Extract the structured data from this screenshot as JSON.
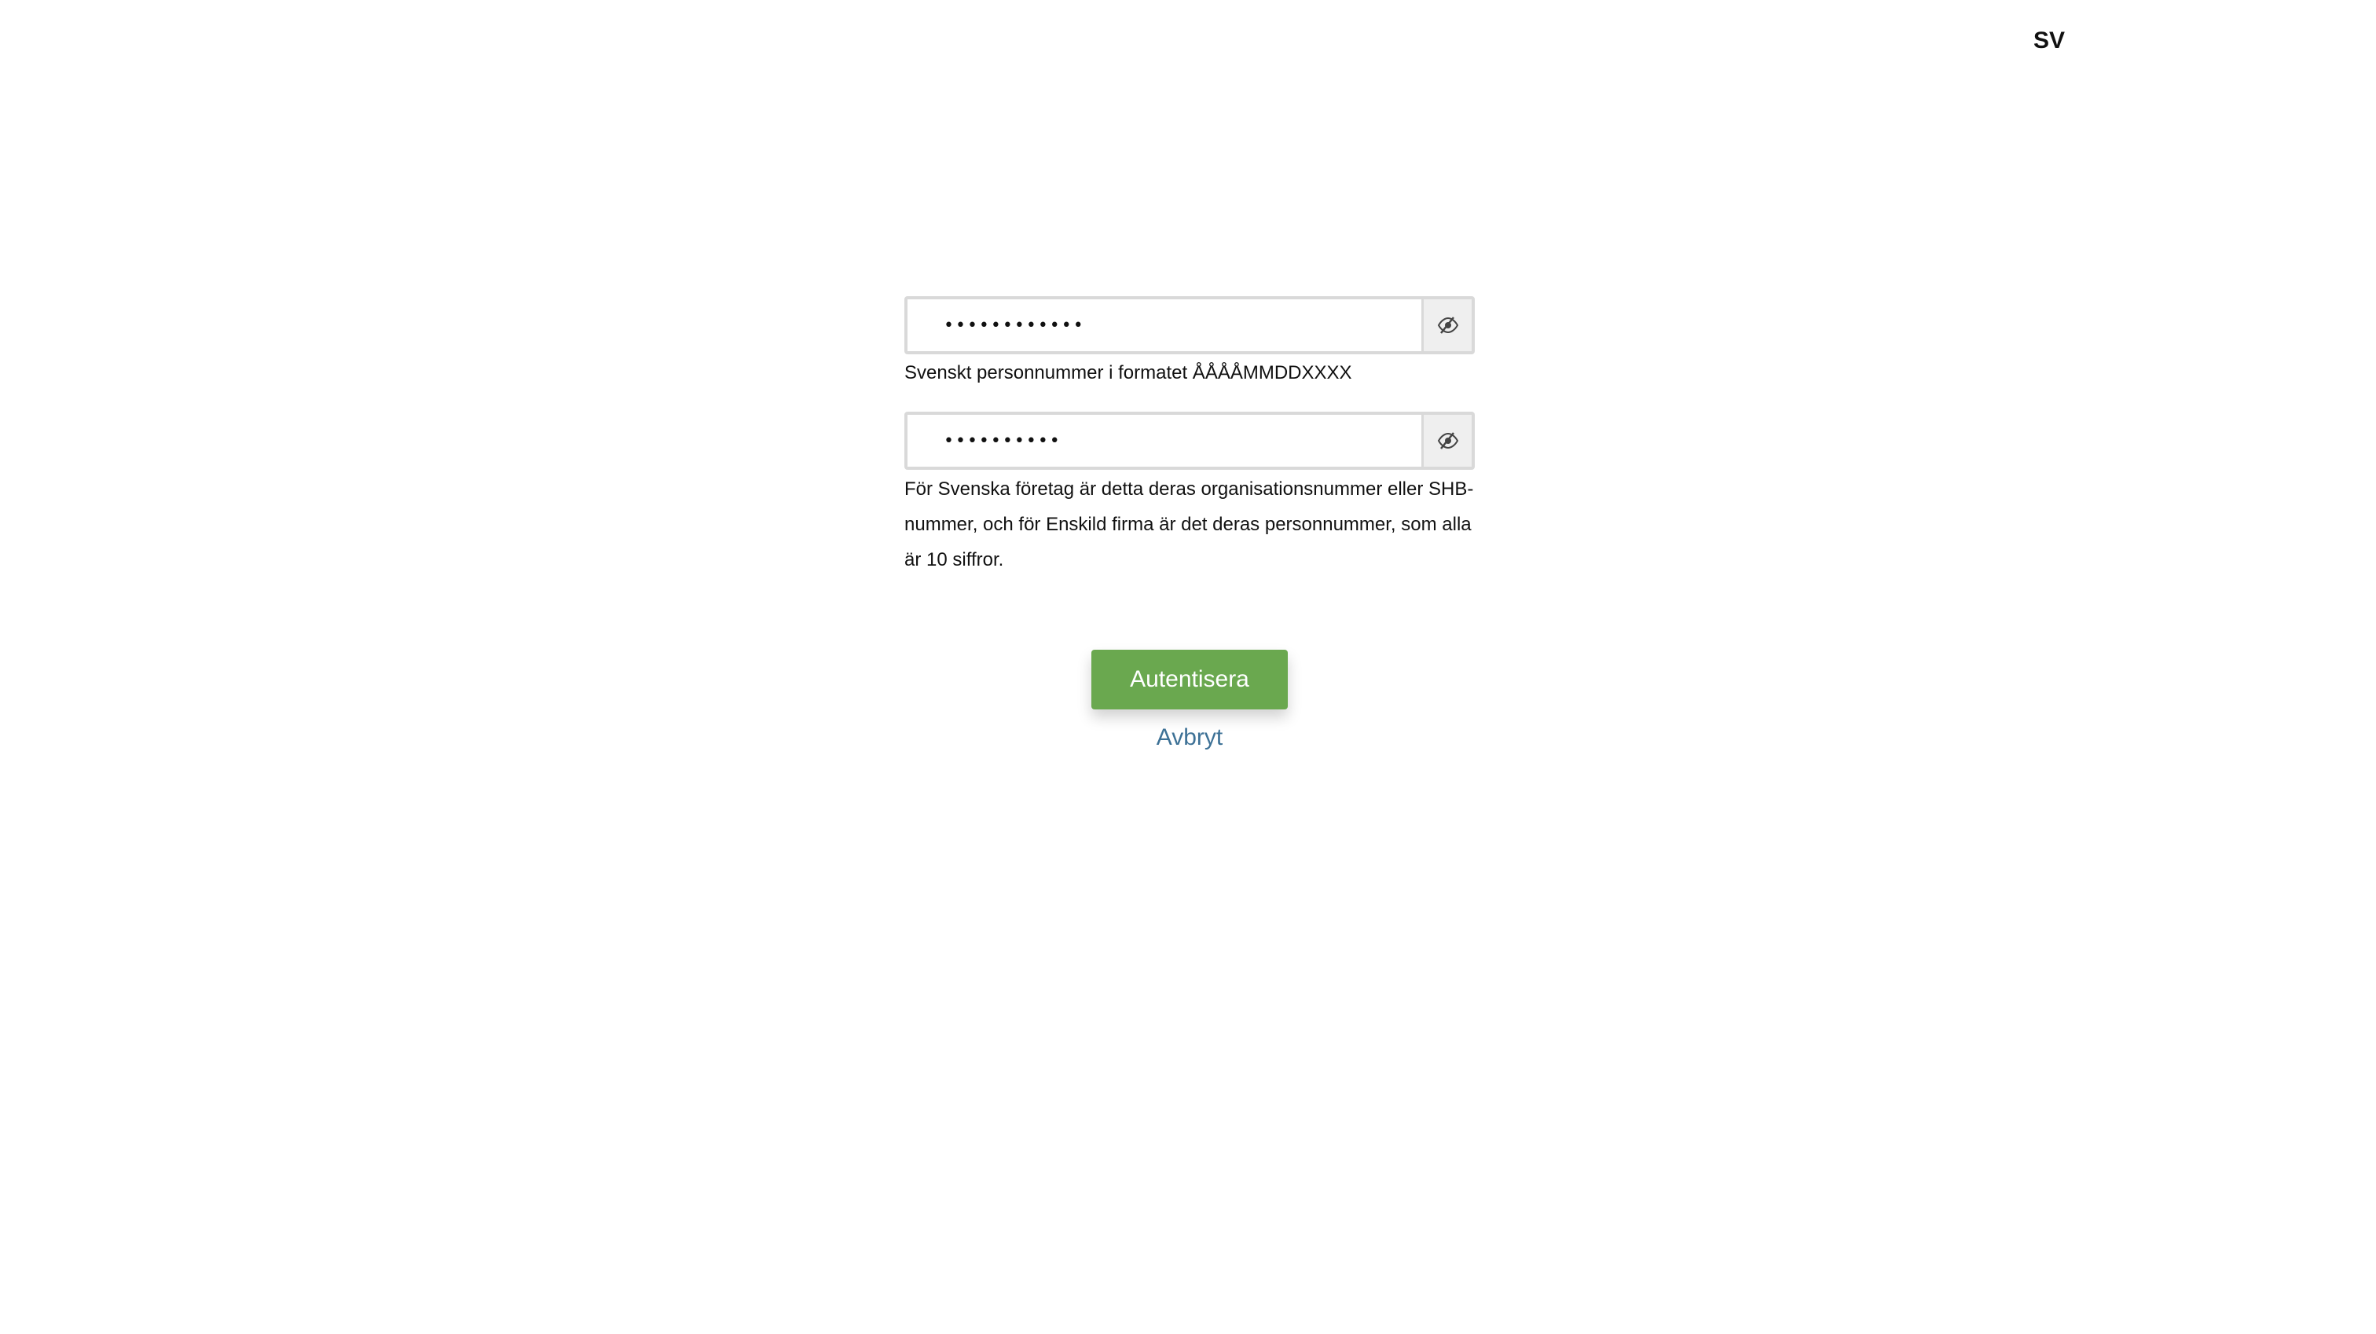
{
  "header": {
    "language": "SV"
  },
  "form": {
    "personal_number": {
      "value": "••••••••••••",
      "help": "Svenskt personnummer i formatet ÅÅÅÅMMDDXXXX",
      "toggle_icon": "eye-slash-icon"
    },
    "organisation_number": {
      "value": "••••••••••",
      "help": "För Svenska företag är detta deras organisationsnummer eller SHB-nummer, och för Enskild firma är det deras personnummer, som alla är 10 siffror.",
      "toggle_icon": "eye-slash-icon"
    }
  },
  "actions": {
    "submit_label": "Autentisera",
    "cancel_label": "Avbryt"
  },
  "colors": {
    "primary_button": "#6aa84f",
    "link": "#3d7196",
    "input_border": "#d9d9d9"
  }
}
